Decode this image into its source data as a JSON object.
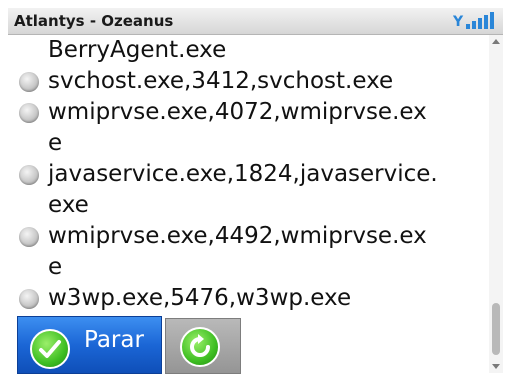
{
  "window": {
    "title": "Atlantys - Ozeanus",
    "signal_icon": "signal-strength-icon"
  },
  "process_list": [
    {
      "text": "BerryAgent.exe",
      "bullet": false
    },
    {
      "text": "svchost.exe,3412,svchost.exe",
      "bullet": true
    },
    {
      "text": "wmiprvse.exe,4072,wmiprvse.ex",
      "bullet": true
    },
    {
      "text": "e",
      "bullet": false
    },
    {
      "text": "javaservice.exe,1824,javaservice.",
      "bullet": true
    },
    {
      "text": "exe",
      "bullet": false
    },
    {
      "text": "wmiprvse.exe,4492,wmiprvse.ex",
      "bullet": true
    },
    {
      "text": "e",
      "bullet": false
    },
    {
      "text": "w3wp.exe,5476,w3wp.exe",
      "bullet": true
    }
  ],
  "actions": {
    "stop_label": "Parar",
    "stop_icon": "check-icon",
    "refresh_icon": "refresh-icon"
  },
  "colors": {
    "stop_button": "#1b66d6",
    "icon_green": "#3fbf23",
    "refresh_button": "#a6a6a6"
  }
}
